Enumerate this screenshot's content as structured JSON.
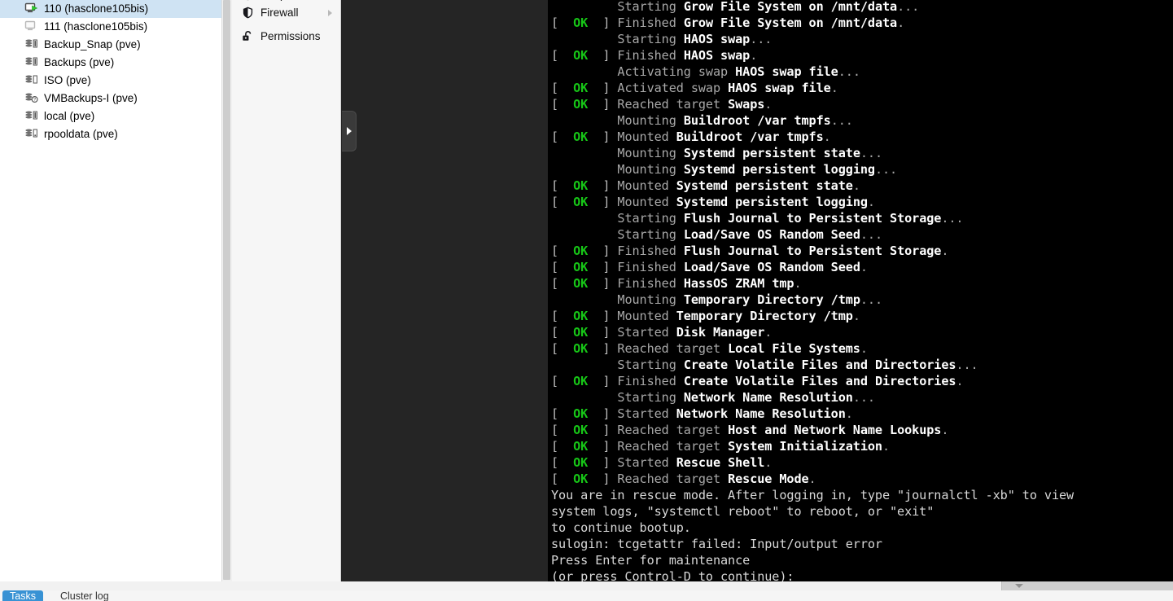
{
  "tree": {
    "items": [
      {
        "label": "110 (hasclone105bis)",
        "icon": "vm-running-icon",
        "selected": true,
        "indent": 0
      },
      {
        "label": "111 (hasclone105bis)",
        "icon": "vm-stopped-icon",
        "selected": false,
        "indent": 0
      },
      {
        "label": "Backup_Snap (pve)",
        "icon": "storage-full-icon",
        "selected": false,
        "indent": 0
      },
      {
        "label": "Backups (pve)",
        "icon": "storage-full-icon",
        "selected": false,
        "indent": 0
      },
      {
        "label": "ISO (pve)",
        "icon": "storage-empty-icon",
        "selected": false,
        "indent": 0
      },
      {
        "label": "VMBackups-I (pve)",
        "icon": "storage-unknown-icon",
        "selected": false,
        "indent": 0
      },
      {
        "label": "local (pve)",
        "icon": "storage-full-icon",
        "selected": false,
        "indent": 0
      },
      {
        "label": "rpooldata (pve)",
        "icon": "storage-low-icon",
        "selected": false,
        "indent": 0
      }
    ]
  },
  "menu": {
    "items": [
      {
        "label": "Snapshots",
        "icon": "snapshot-icon",
        "has_arrow": false,
        "clipped": true
      },
      {
        "label": "Firewall",
        "icon": "shield-icon",
        "has_arrow": true,
        "clipped": false
      },
      {
        "label": "Permissions",
        "icon": "unlock-icon",
        "has_arrow": false,
        "clipped": false
      }
    ]
  },
  "collapse_handle": {
    "icon": "chevron-right-icon"
  },
  "console": {
    "lines": [
      {
        "ok": null,
        "verb": "Starting ",
        "unit": "Grow File System on /mnt/data",
        "tail": "..."
      },
      {
        "ok": "OK",
        "verb": "Finished ",
        "unit": "Grow File System on /mnt/data",
        "tail": "."
      },
      {
        "ok": null,
        "verb": "Starting ",
        "unit": "HAOS swap",
        "tail": "..."
      },
      {
        "ok": "OK",
        "verb": "Finished ",
        "unit": "HAOS swap",
        "tail": "."
      },
      {
        "ok": null,
        "verb": "Activating swap ",
        "unit": "HAOS swap file",
        "tail": "..."
      },
      {
        "ok": "OK",
        "verb": "Activated swap ",
        "unit": "HAOS swap file",
        "tail": "."
      },
      {
        "ok": "OK",
        "verb": "Reached target ",
        "unit": "Swaps",
        "tail": "."
      },
      {
        "ok": null,
        "verb": "Mounting ",
        "unit": "Buildroot /var tmpfs",
        "tail": "..."
      },
      {
        "ok": "OK",
        "verb": "Mounted ",
        "unit": "Buildroot /var tmpfs",
        "tail": "."
      },
      {
        "ok": null,
        "verb": "Mounting ",
        "unit": "Systemd persistent state",
        "tail": "..."
      },
      {
        "ok": null,
        "verb": "Mounting ",
        "unit": "Systemd persistent logging",
        "tail": "..."
      },
      {
        "ok": "OK",
        "verb": "Mounted ",
        "unit": "Systemd persistent state",
        "tail": "."
      },
      {
        "ok": "OK",
        "verb": "Mounted ",
        "unit": "Systemd persistent logging",
        "tail": "."
      },
      {
        "ok": null,
        "verb": "Starting ",
        "unit": "Flush Journal to Persistent Storage",
        "tail": "..."
      },
      {
        "ok": null,
        "verb": "Starting ",
        "unit": "Load/Save OS Random Seed",
        "tail": "..."
      },
      {
        "ok": "OK",
        "verb": "Finished ",
        "unit": "Flush Journal to Persistent Storage",
        "tail": "."
      },
      {
        "ok": "OK",
        "verb": "Finished ",
        "unit": "Load/Save OS Random Seed",
        "tail": "."
      },
      {
        "ok": "OK",
        "verb": "Finished ",
        "unit": "HassOS ZRAM tmp",
        "tail": "."
      },
      {
        "ok": null,
        "verb": "Mounting ",
        "unit": "Temporary Directory /tmp",
        "tail": "..."
      },
      {
        "ok": "OK",
        "verb": "Mounted ",
        "unit": "Temporary Directory /tmp",
        "tail": "."
      },
      {
        "ok": "OK",
        "verb": "Started ",
        "unit": "Disk Manager",
        "tail": "."
      },
      {
        "ok": "OK",
        "verb": "Reached target ",
        "unit": "Local File Systems",
        "tail": "."
      },
      {
        "ok": null,
        "verb": "Starting ",
        "unit": "Create Volatile Files and Directories",
        "tail": "..."
      },
      {
        "ok": "OK",
        "verb": "Finished ",
        "unit": "Create Volatile Files and Directories",
        "tail": "."
      },
      {
        "ok": null,
        "verb": "Starting ",
        "unit": "Network Name Resolution",
        "tail": "..."
      },
      {
        "ok": "OK",
        "verb": "Started ",
        "unit": "Network Name Resolution",
        "tail": "."
      },
      {
        "ok": "OK",
        "verb": "Reached target ",
        "unit": "Host and Network Name Lookups",
        "tail": "."
      },
      {
        "ok": "OK",
        "verb": "Reached target ",
        "unit": "System Initialization",
        "tail": "."
      },
      {
        "ok": "OK",
        "verb": "Started ",
        "unit": "Rescue Shell",
        "tail": "."
      },
      {
        "ok": "OK",
        "verb": "Reached target ",
        "unit": "Rescue Mode",
        "tail": "."
      }
    ],
    "message_lines": [
      "You are in rescue mode. After logging in, type \"journalctl -xb\" to view",
      "system logs, \"systemctl reboot\" to reboot, or \"exit\"",
      "to continue bootup.",
      "sulogin: tcgetattr failed: Input/output error",
      "Press Enter for maintenance",
      "(or press Control-D to continue):"
    ]
  },
  "bottom_bar": {
    "tabs": [
      {
        "label": "Tasks",
        "active": true
      },
      {
        "label": "Cluster log",
        "active": false
      }
    ]
  },
  "colors": {
    "selection": "#cfe3f3",
    "accent": "#3892d4",
    "console_bg": "#000000",
    "console_gap_bg": "#252525",
    "ok_green": "#17c617",
    "console_dim": "#a8a8a8",
    "console_bright": "#ffffff"
  }
}
